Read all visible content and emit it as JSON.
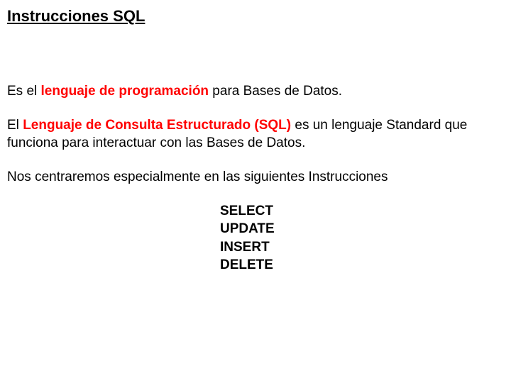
{
  "title": "Instrucciones SQL",
  "p1": {
    "pre": "Es el ",
    "hl": "lenguaje de programación",
    "post": " para Bases de Datos."
  },
  "p2": {
    "pre": "El ",
    "hl": "Lenguaje de Consulta Estructurado (SQL)",
    "post": " es un lenguaje Standard que funciona para interactuar con las Bases de Datos."
  },
  "p3": "Nos centraremos especialmente en las siguientes Instrucciones",
  "instructions": {
    "i0": "SELECT",
    "i1": "UPDATE",
    "i2": "INSERT",
    "i3": "DELETE"
  }
}
